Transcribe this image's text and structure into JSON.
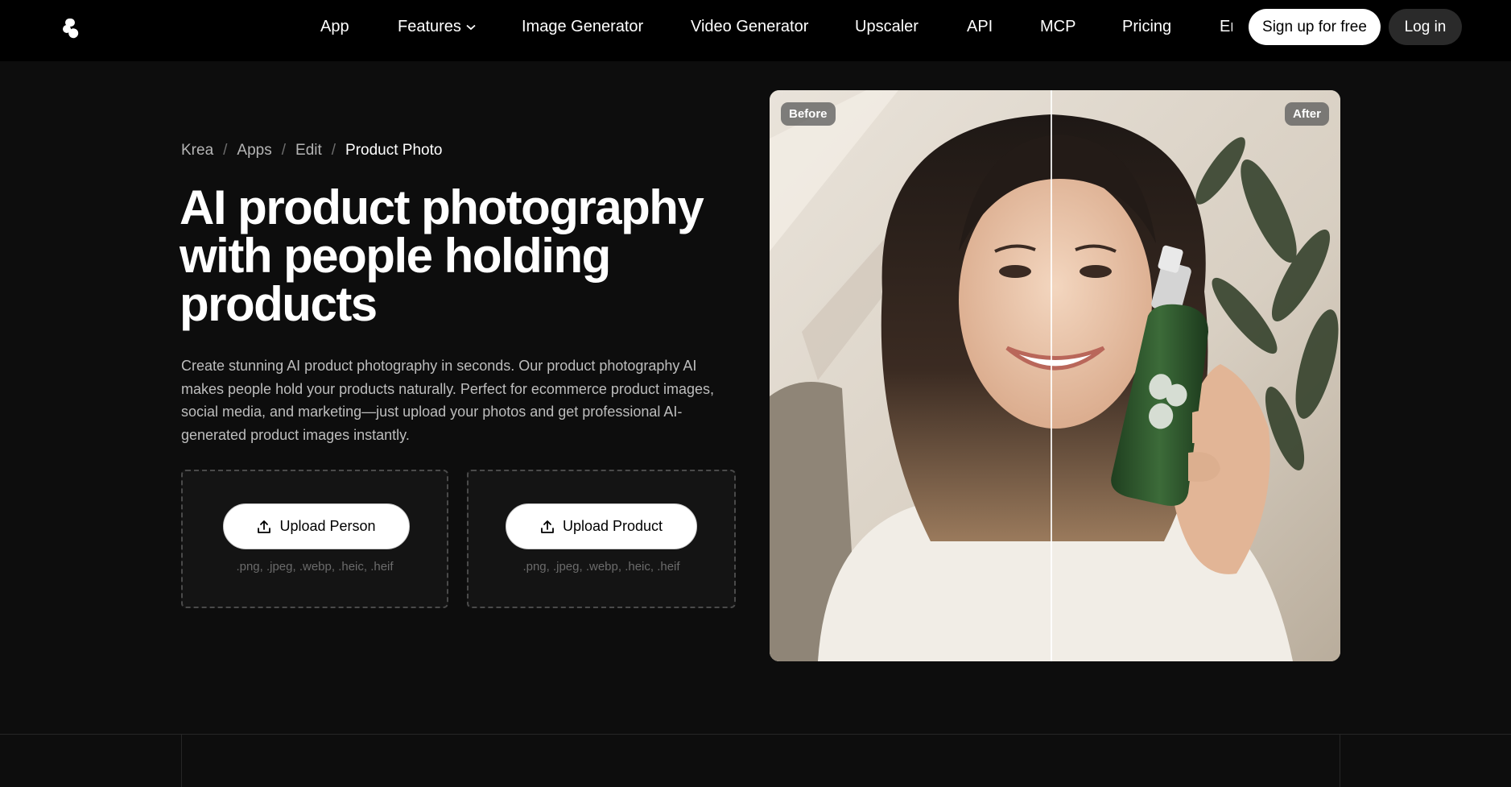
{
  "header": {
    "logo_icon": "krea-logo-icon",
    "nav": [
      {
        "label": "App"
      },
      {
        "label": "Features",
        "has_dropdown": true
      },
      {
        "label": "Image Generator"
      },
      {
        "label": "Video Generator"
      },
      {
        "label": "Upscaler"
      },
      {
        "label": "API"
      },
      {
        "label": "MCP"
      },
      {
        "label": "Pricing"
      },
      {
        "label": "Enterprise"
      }
    ],
    "signup_label": "Sign up for free",
    "login_label": "Log in"
  },
  "breadcrumb": {
    "items": [
      "Krea",
      "Apps",
      "Edit"
    ],
    "current": "Product Photo",
    "separator": "/"
  },
  "hero": {
    "title": "AI product photography with people holding products",
    "description": "Create stunning AI product photography in seconds. Our product photography AI makes people hold your products naturally. Perfect for ecommerce product images, social media, and marketing—just upload your photos and get professional AI-generated product images instantly."
  },
  "uploads": [
    {
      "label": "Upload Person",
      "icon": "upload-icon",
      "hint": ".png, .jpeg, .webp, .heic, .heif"
    },
    {
      "label": "Upload Product",
      "icon": "upload-icon",
      "hint": ".png, .jpeg, .webp, .heic, .heif"
    }
  ],
  "comparison": {
    "before_label": "Before",
    "after_label": "After"
  },
  "colors": {
    "background": "#0d0d0d",
    "topbar": "#000000",
    "primary_button": "#ffffff",
    "secondary_button": "#2a2a2a",
    "bottle_green": "#2f5a2e"
  }
}
